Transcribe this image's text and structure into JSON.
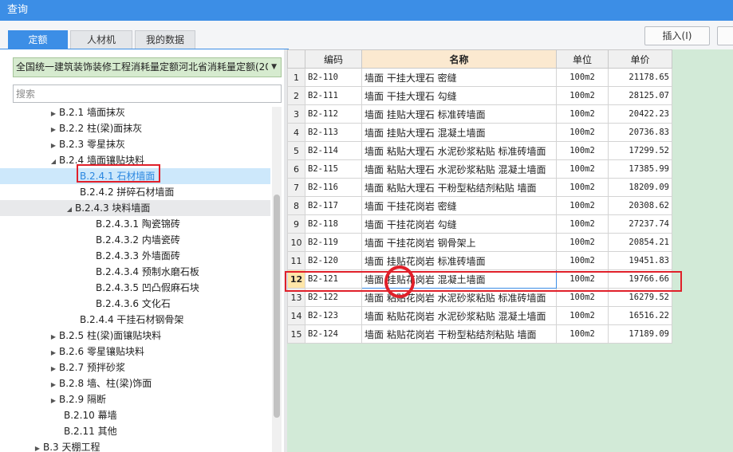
{
  "window": {
    "title": "查询"
  },
  "tabs": [
    {
      "label": "定额",
      "active": true
    },
    {
      "label": "人材机",
      "active": false
    },
    {
      "label": "我的数据",
      "active": false
    }
  ],
  "toolbar": {
    "insert_label": "插入(I)"
  },
  "left": {
    "quota_library": "全国统一建筑装饰装修工程消耗量定额河北省消耗量定额(20",
    "search_placeholder": "搜索",
    "tree": [
      {
        "label": "B.2.1 墙面抹灰",
        "arrow": "▶"
      },
      {
        "label": "B.2.2 柱(梁)面抹灰",
        "arrow": "▶"
      },
      {
        "label": "B.2.3 零星抹灰",
        "arrow": "▶"
      },
      {
        "label": "B.2.4 墙面镶贴块料",
        "arrow": "◢"
      },
      {
        "label": "B.2.4.1 石材墙面",
        "arrow": ""
      },
      {
        "label": "B.2.4.2 拼碎石材墙面",
        "arrow": ""
      },
      {
        "label": "B.2.4.3 块料墙面",
        "arrow": "◢"
      },
      {
        "label": "B.2.4.3.1 陶瓷锦砖",
        "arrow": ""
      },
      {
        "label": "B.2.4.3.2 内墙瓷砖",
        "arrow": ""
      },
      {
        "label": "B.2.4.3.3 外墙面砖",
        "arrow": ""
      },
      {
        "label": "B.2.4.3.4 预制水磨石板",
        "arrow": ""
      },
      {
        "label": "B.2.4.3.5 凹凸假麻石块",
        "arrow": ""
      },
      {
        "label": "B.2.4.3.6 文化石",
        "arrow": ""
      },
      {
        "label": "B.2.4.4 干挂石材钢骨架",
        "arrow": ""
      },
      {
        "label": "B.2.5 柱(梁)面镶贴块料",
        "arrow": "▶"
      },
      {
        "label": "B.2.6 零星镶贴块料",
        "arrow": "▶"
      },
      {
        "label": "B.2.7 预拌砂浆",
        "arrow": "▶"
      },
      {
        "label": "B.2.8 墙、柱(梁)饰面",
        "arrow": "▶"
      },
      {
        "label": "B.2.9 隔断",
        "arrow": "▶"
      },
      {
        "label": "B.2.10 幕墙",
        "arrow": ""
      },
      {
        "label": "B.2.11 其他",
        "arrow": ""
      },
      {
        "label": "B.3 天棚工程",
        "arrow": "▶"
      }
    ]
  },
  "grid": {
    "columns": [
      "编码",
      "名称",
      "单位",
      "单价"
    ],
    "rows": [
      {
        "n": "1",
        "code": "B2-110",
        "name": "墙面 干挂大理石 密缝",
        "unit": "100m2",
        "price": "21178.65"
      },
      {
        "n": "2",
        "code": "B2-111",
        "name": "墙面 干挂大理石 勾缝",
        "unit": "100m2",
        "price": "28125.07"
      },
      {
        "n": "3",
        "code": "B2-112",
        "name": "墙面 挂贴大理石 标准砖墙面",
        "unit": "100m2",
        "price": "20422.23"
      },
      {
        "n": "4",
        "code": "B2-113",
        "name": "墙面 挂贴大理石 混凝土墙面",
        "unit": "100m2",
        "price": "20736.83"
      },
      {
        "n": "5",
        "code": "B2-114",
        "name": "墙面 粘贴大理石 水泥砂浆粘贴 标准砖墙面",
        "unit": "100m2",
        "price": "17299.52"
      },
      {
        "n": "6",
        "code": "B2-115",
        "name": "墙面 粘贴大理石 水泥砂浆粘贴 混凝土墙面",
        "unit": "100m2",
        "price": "17385.99"
      },
      {
        "n": "7",
        "code": "B2-116",
        "name": "墙面 粘贴大理石 干粉型粘结剂粘贴 墙面",
        "unit": "100m2",
        "price": "18209.09"
      },
      {
        "n": "8",
        "code": "B2-117",
        "name": "墙面 干挂花岗岩 密缝",
        "unit": "100m2",
        "price": "20308.62"
      },
      {
        "n": "9",
        "code": "B2-118",
        "name": "墙面 干挂花岗岩 勾缝",
        "unit": "100m2",
        "price": "27237.74"
      },
      {
        "n": "10",
        "code": "B2-119",
        "name": "墙面 干挂花岗岩 钢骨架上",
        "unit": "100m2",
        "price": "20854.21"
      },
      {
        "n": "11",
        "code": "B2-120",
        "name": "墙面 挂贴花岗岩 标准砖墙面",
        "unit": "100m2",
        "price": "19451.83"
      },
      {
        "n": "12",
        "code": "B2-121",
        "name": "墙面 挂贴花岗岩 混凝土墙面",
        "unit": "100m2",
        "price": "19766.66"
      },
      {
        "n": "13",
        "code": "B2-122",
        "name": "墙面 粘贴花岗岩 水泥砂浆粘贴 标准砖墙面",
        "unit": "100m2",
        "price": "16279.52"
      },
      {
        "n": "14",
        "code": "B2-123",
        "name": "墙面 粘贴花岗岩 水泥砂浆粘贴 混凝土墙面",
        "unit": "100m2",
        "price": "16516.22"
      },
      {
        "n": "15",
        "code": "B2-124",
        "name": "墙面 粘贴花岗岩 干粉型粘结剂粘贴 墙面",
        "unit": "100m2",
        "price": "17189.09"
      }
    ]
  }
}
